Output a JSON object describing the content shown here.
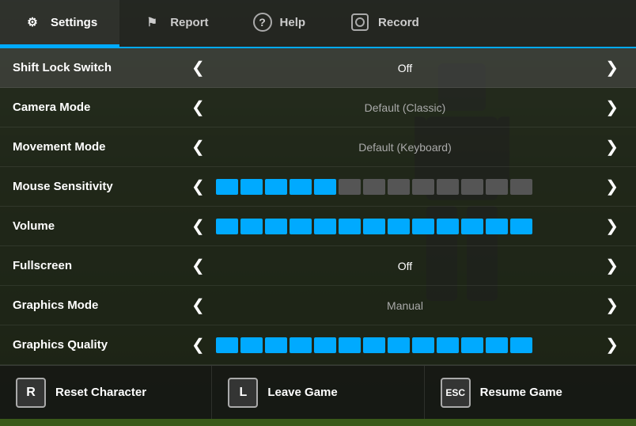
{
  "nav": {
    "tabs": [
      {
        "id": "settings",
        "label": "Settings",
        "active": true
      },
      {
        "id": "report",
        "label": "Report",
        "active": false
      },
      {
        "id": "help",
        "label": "Help",
        "active": false
      },
      {
        "id": "record",
        "label": "Record",
        "active": false
      }
    ]
  },
  "settings": {
    "rows": [
      {
        "id": "shift-lock",
        "label": "Shift Lock Switch",
        "type": "toggle",
        "value": "Off",
        "value_style": "white"
      },
      {
        "id": "camera-mode",
        "label": "Camera Mode",
        "type": "toggle",
        "value": "Default (Classic)",
        "value_style": "dim"
      },
      {
        "id": "movement-mode",
        "label": "Movement Mode",
        "type": "toggle",
        "value": "Default (Keyboard)",
        "value_style": "dim"
      },
      {
        "id": "mouse-sensitivity",
        "label": "Mouse Sensitivity",
        "type": "slider",
        "filled": 5,
        "total": 13
      },
      {
        "id": "volume",
        "label": "Volume",
        "type": "slider",
        "filled": 13,
        "total": 13
      },
      {
        "id": "fullscreen",
        "label": "Fullscreen",
        "type": "toggle",
        "value": "Off",
        "value_style": "white"
      },
      {
        "id": "graphics-mode",
        "label": "Graphics Mode",
        "type": "toggle",
        "value": "Manual",
        "value_style": "dim"
      },
      {
        "id": "graphics-quality",
        "label": "Graphics Quality",
        "type": "slider",
        "filled": 13,
        "total": 13
      }
    ]
  },
  "actions": [
    {
      "id": "reset",
      "key": "R",
      "label": "Reset Character"
    },
    {
      "id": "leave",
      "key": "L",
      "label": "Leave Game"
    },
    {
      "id": "resume",
      "key": "ESC",
      "label": "Resume Game"
    }
  ],
  "icons": {
    "settings": "⚙",
    "report": "⚑",
    "help": "?",
    "record": "◎",
    "arrow_left": "❮",
    "arrow_right": "❯"
  }
}
